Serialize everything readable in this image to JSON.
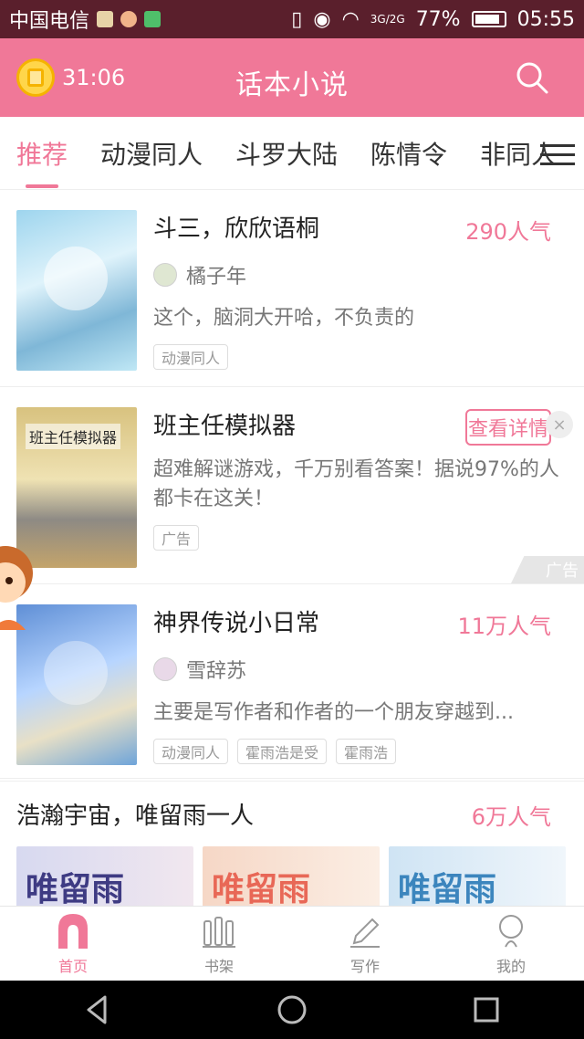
{
  "status": {
    "carrier": "中国电信",
    "battery": "77%",
    "time": "05:55",
    "network": "3G/2G"
  },
  "header": {
    "timer": "31:06",
    "app_title": "话本小说"
  },
  "tabs": [
    "推荐",
    "动漫同人",
    "斗罗大陆",
    "陈情令",
    "非同人"
  ],
  "books": [
    {
      "title": "斗三，欣欣语桐",
      "popularity": "290人气",
      "author": "橘子年",
      "desc": "这个，脑洞大开哈，不负责的",
      "tags": [
        "动漫同人"
      ]
    },
    {
      "title": "班主任模拟器",
      "popularity": "",
      "author": "",
      "desc": "超难解谜游戏，千万别看答案！据说97%的人都卡在这关！",
      "tags": [
        "广告"
      ],
      "button": "查看详情",
      "cover_text": "班主任模拟器"
    },
    {
      "title": "神界传说小日常",
      "popularity": "11万人气",
      "author": "雪辞苏",
      "desc": "主要是写作者和作者的一个朋友穿越到...",
      "tags": [
        "动漫同人",
        "霍雨浩是受",
        "霍雨浩"
      ]
    }
  ],
  "ad_label": "广告",
  "hero": {
    "title": "浩瀚宇宙，唯留雨一人",
    "popularity": "6万人气",
    "image_text": "唯留雨"
  },
  "bottom_nav": [
    {
      "label": "首页"
    },
    {
      "label": "书架"
    },
    {
      "label": "写作"
    },
    {
      "label": "我的"
    }
  ],
  "colors": {
    "accent": "#f07898",
    "statusbar": "#5a1f2c"
  }
}
